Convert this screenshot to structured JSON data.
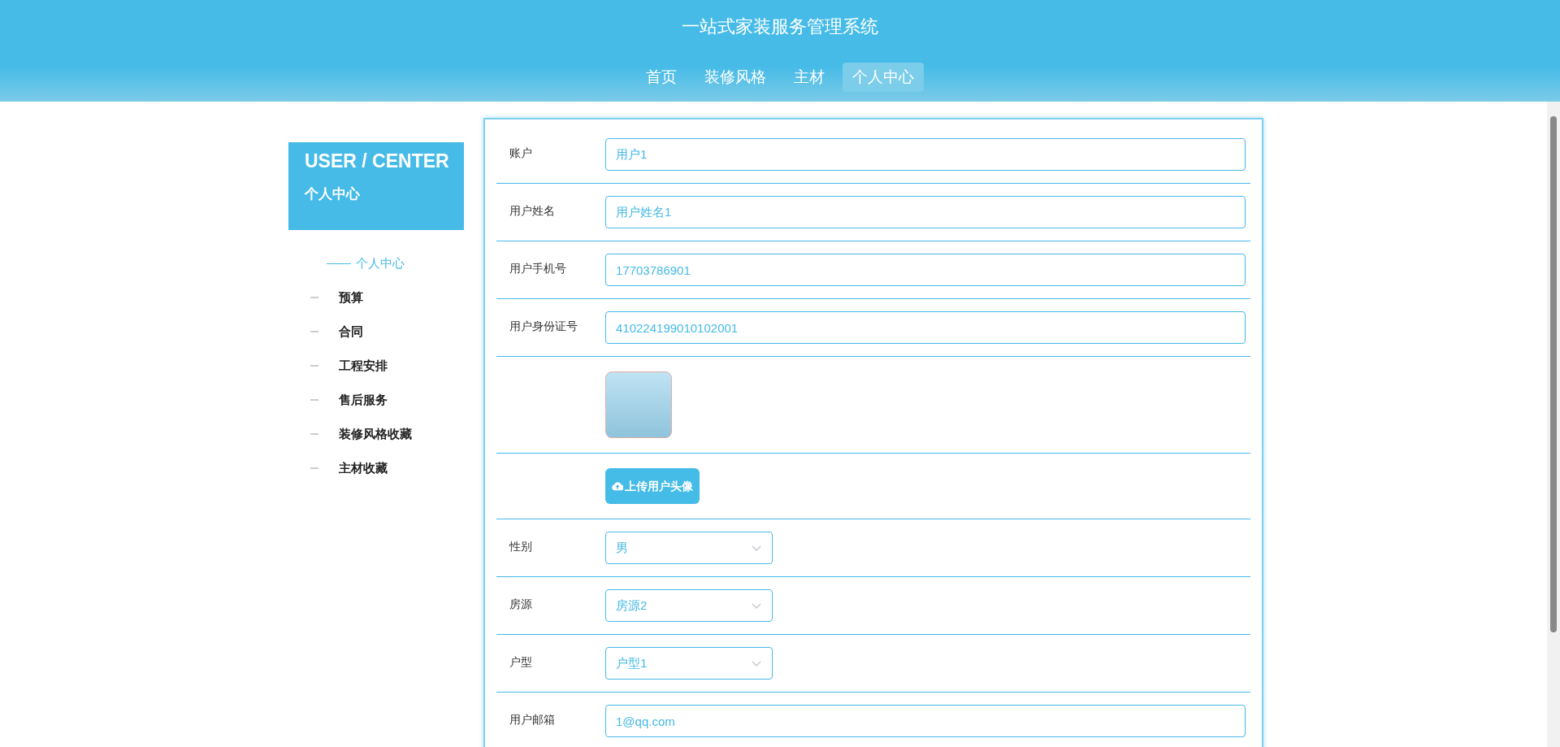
{
  "header": {
    "title": "一站式家装服务管理系统"
  },
  "nav": [
    {
      "label": "首页",
      "selected": false
    },
    {
      "label": "装修风格",
      "selected": false
    },
    {
      "label": "主材",
      "selected": false
    },
    {
      "label": "个人中心",
      "selected": true
    }
  ],
  "sidebar": {
    "title": "USER / CENTER",
    "subtitle": "个人中心",
    "items": [
      {
        "label": "个人中心",
        "selected": true
      },
      {
        "label": "预算",
        "selected": false
      },
      {
        "label": "合同",
        "selected": false
      },
      {
        "label": "工程安排",
        "selected": false
      },
      {
        "label": "售后服务",
        "selected": false
      },
      {
        "label": "装修风格收藏",
        "selected": false
      },
      {
        "label": "主材收藏",
        "selected": false
      }
    ]
  },
  "form": [
    {
      "kind": "text",
      "label": "账户",
      "value": "用户1"
    },
    {
      "kind": "text",
      "label": "用户姓名",
      "value": "用户姓名1"
    },
    {
      "kind": "text",
      "label": "用户手机号",
      "value": "17703786901"
    },
    {
      "kind": "text",
      "label": "用户身份证号",
      "value": "410224199010102001"
    },
    {
      "kind": "image"
    },
    {
      "kind": "upload",
      "button": "上传用户头像"
    },
    {
      "kind": "select",
      "label": "性别",
      "value": "男"
    },
    {
      "kind": "select",
      "label": "房源",
      "value": "房源2"
    },
    {
      "kind": "select",
      "label": "户型",
      "value": "户型1"
    },
    {
      "kind": "text",
      "label": "用户邮箱",
      "value": "1@qq.com"
    }
  ]
}
